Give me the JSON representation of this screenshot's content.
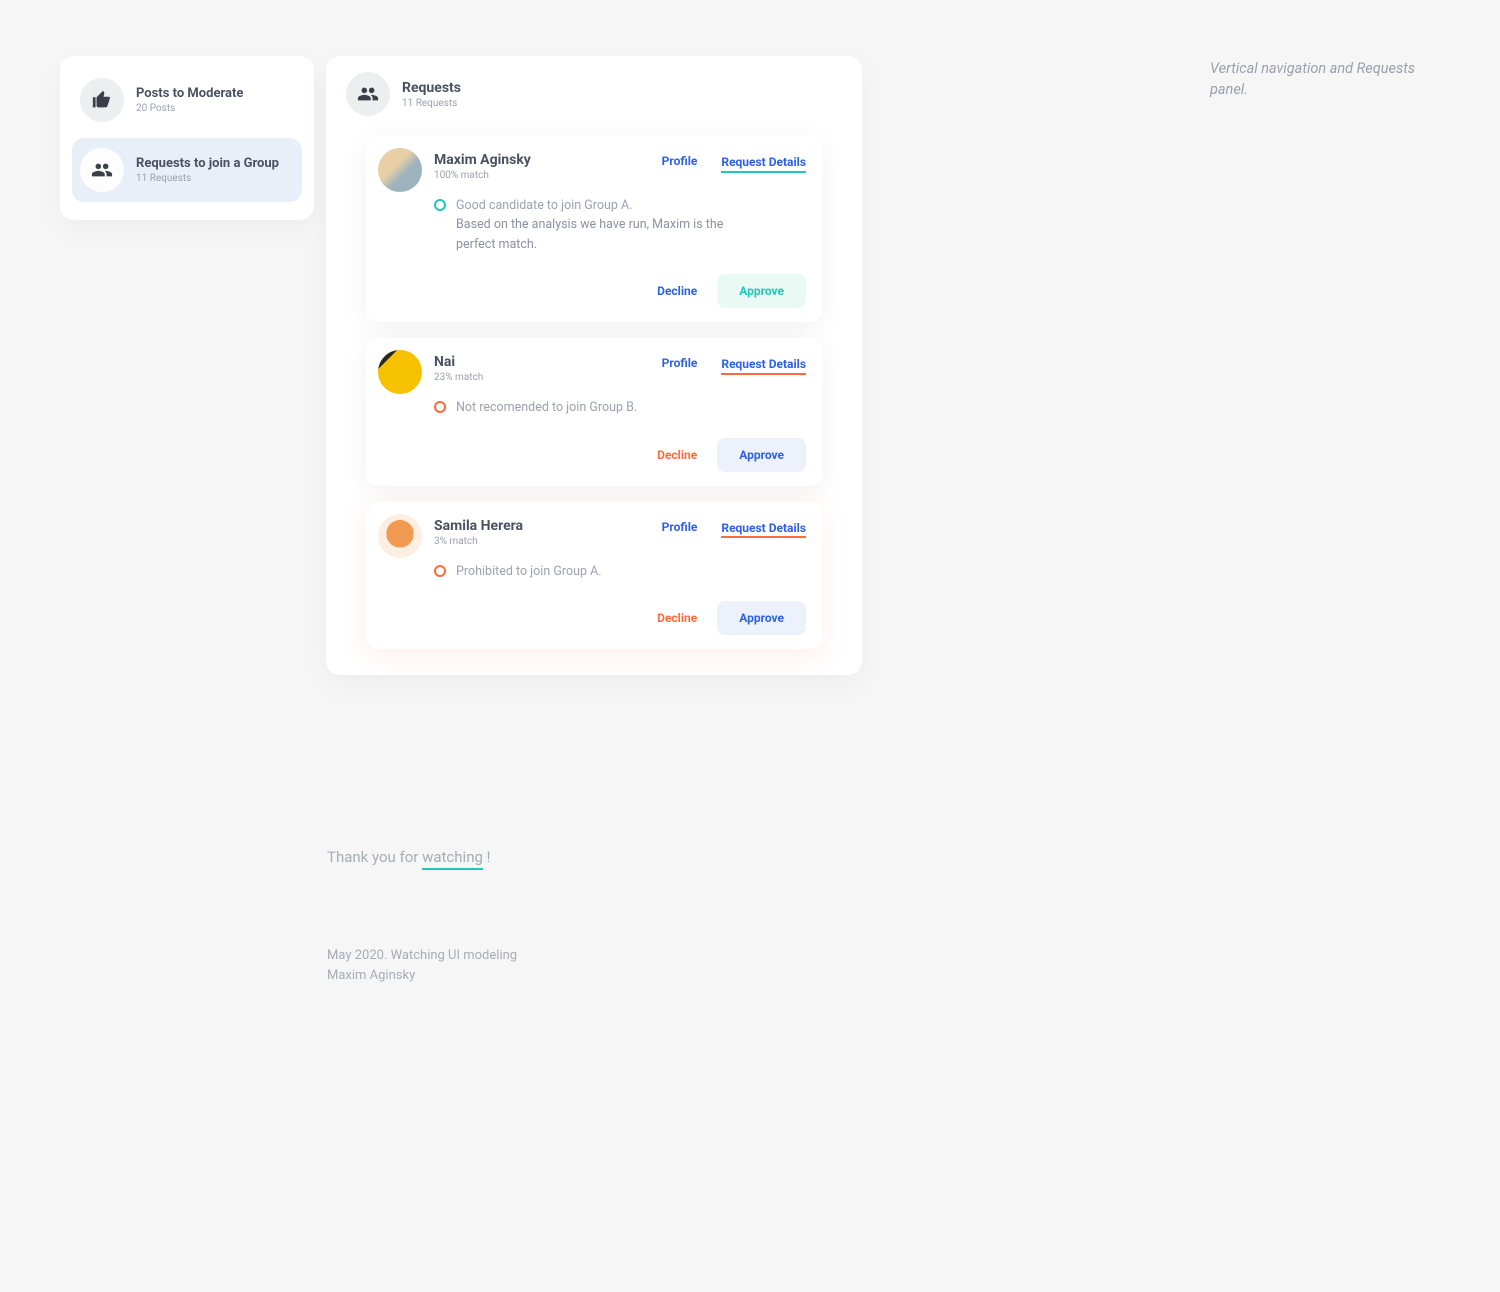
{
  "sidebar": {
    "items": [
      {
        "title": "Posts to Moderate",
        "sub": "20 Posts"
      },
      {
        "title": "Requests to join a Group",
        "sub": "11 Requests"
      }
    ]
  },
  "main": {
    "title": "Requests",
    "sub": "11 Requests"
  },
  "requests": [
    {
      "name": "Maxim Aginsky",
      "match": "100% match",
      "profile_label": "Profile",
      "details_label": "Request Details",
      "note_title": "Good candidate to join Group A.",
      "note_body": "Based on the analysis we have run, Maxim is the perfect match.",
      "decline_label": "Decline",
      "approve_label": "Approve",
      "status": "good"
    },
    {
      "name": "Nai",
      "match": "23% match",
      "profile_label": "Profile",
      "details_label": "Request Details",
      "note_title": "Not recomended to join Group B.",
      "note_body": "",
      "decline_label": "Decline",
      "approve_label": "Approve",
      "status": "warn"
    },
    {
      "name": "Samila Herera",
      "match": "3% match",
      "profile_label": "Profile",
      "details_label": "Request Details",
      "note_title": "Prohibited to join Group A.",
      "note_body": "",
      "decline_label": "Decline",
      "approve_label": "Approve",
      "status": "bad"
    }
  ],
  "annotation": "Vertical navigation and Requests panel.",
  "footer": {
    "thank_pre": "Thank you for ",
    "thank_word": "watching",
    "thank_post": " !",
    "credit1": "May 2020. Watching UI modeling",
    "credit2": "Maxim Aginsky"
  }
}
